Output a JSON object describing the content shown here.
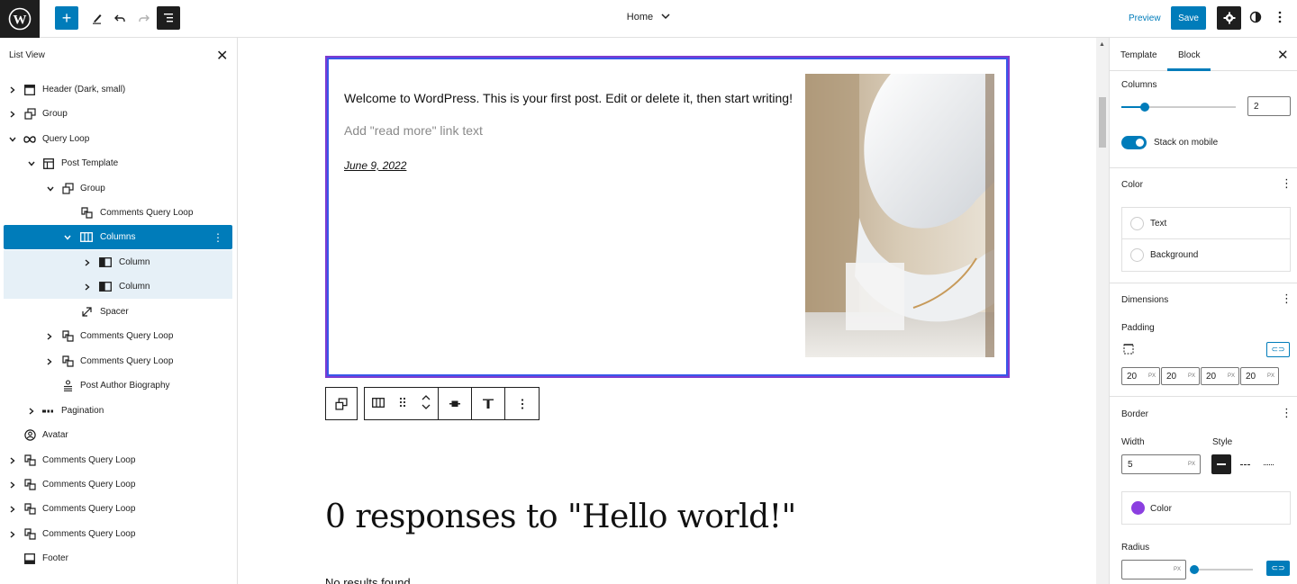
{
  "topbar": {
    "document_title": "Home",
    "preview_label": "Preview",
    "save_label": "Save"
  },
  "listview": {
    "title": "List View",
    "items": [
      {
        "label": "Header (Dark, small)",
        "icon": "template-part-icon"
      },
      {
        "label": "Group",
        "icon": "group-icon"
      },
      {
        "label": "Query Loop",
        "icon": "loop-icon"
      },
      {
        "label": "Post Template",
        "icon": "layout-icon"
      },
      {
        "label": "Group",
        "icon": "group-icon"
      },
      {
        "label": "Comments Query Loop",
        "icon": "comments-icon"
      },
      {
        "label": "Columns",
        "icon": "columns-icon"
      },
      {
        "label": "Column",
        "icon": "column-icon"
      },
      {
        "label": "Column",
        "icon": "column-icon"
      },
      {
        "label": "Spacer",
        "icon": "resize-icon"
      },
      {
        "label": "Comments Query Loop",
        "icon": "comments-icon"
      },
      {
        "label": "Comments Query Loop",
        "icon": "comments-icon"
      },
      {
        "label": "Post Author Biography",
        "icon": "author-icon"
      },
      {
        "label": "Pagination",
        "icon": "pagination-icon"
      },
      {
        "label": "Avatar",
        "icon": "avatar-icon"
      },
      {
        "label": "Comments Query Loop",
        "icon": "comments-icon"
      },
      {
        "label": "Comments Query Loop",
        "icon": "comments-icon"
      },
      {
        "label": "Comments Query Loop",
        "icon": "comments-icon"
      },
      {
        "label": "Comments Query Loop",
        "icon": "comments-icon"
      },
      {
        "label": "Footer",
        "icon": "footer-icon"
      }
    ]
  },
  "canvas": {
    "post_excerpt": "Welcome to WordPress. This is your first post. Edit or delete it, then start writing!",
    "read_more_placeholder": "Add \"read more\" link text",
    "post_date": "June 9, 2022",
    "responses_heading": "0 responses to \"Hello world!\"",
    "no_results": "No results found."
  },
  "sidebar": {
    "tabs": [
      "Template",
      "Block"
    ],
    "active_tab": "Block",
    "columns_label": "Columns",
    "columns_value": "2",
    "stack_label": "Stack on mobile",
    "stack_enabled": true,
    "color_heading": "Color",
    "color_text_label": "Text",
    "color_background_label": "Background",
    "dimensions_heading": "Dimensions",
    "padding_label": "Padding",
    "padding_values": [
      "20",
      "20",
      "20",
      "20"
    ],
    "padding_unit": "PX",
    "border_heading": "Border",
    "width_label": "Width",
    "style_label": "Style",
    "border_width_value": "5",
    "border_color_label": "Color",
    "border_color": "#8b3fe0",
    "radius_label": "Radius"
  },
  "colors": {
    "accent": "#007cba",
    "dark": "#1e1e1e",
    "selection_outline": "#7e3bd0"
  }
}
